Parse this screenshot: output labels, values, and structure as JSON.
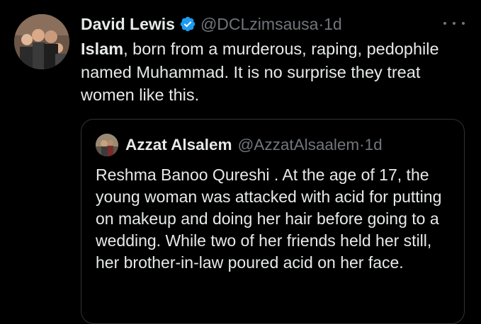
{
  "tweet": {
    "author": {
      "display_name": "David Lewis",
      "handle": "@DCLzimsausa",
      "verified_icon": "verified-badge-icon",
      "verified_color": "#1d9bf0"
    },
    "separator": "·",
    "time": "1d",
    "more_icon": "more-horizontal-icon",
    "text_bold": "Islam",
    "text_rest": ", born from a murderous, raping, pedophile named Muhammad.  It is no surprise they treat women like this."
  },
  "quoted_tweet": {
    "author": {
      "display_name": "Azzat Alsalem",
      "handle": "@AzzatAlsaalem"
    },
    "separator": "·",
    "time": "1d",
    "text": "Reshma Banoo Qureshi . At the age of 17, the young woman was attacked with acid for putting on makeup and doing her hair before going to a wedding. While two of her friends held her still, her brother-in-law poured acid on her face."
  },
  "colors": {
    "background": "#000000",
    "primary_text": "#e7e9ea",
    "secondary_text": "#71767b",
    "border": "#2f3336",
    "accent": "#1d9bf0"
  }
}
